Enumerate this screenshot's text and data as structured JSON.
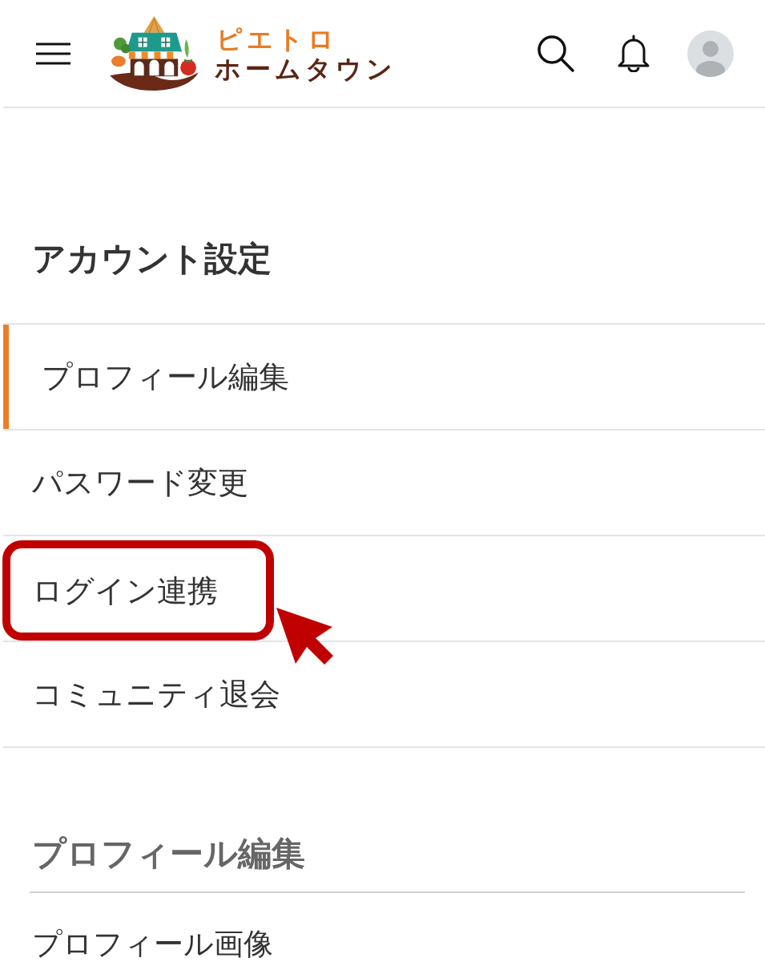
{
  "header": {
    "logo": {
      "line_1": "ピエトロ",
      "line_2": "ホームタウン"
    }
  },
  "account_settings": {
    "title": "アカウント設定",
    "menu": [
      {
        "label": "プロフィール編集",
        "selected": true,
        "highlighted": false
      },
      {
        "label": "パスワード変更",
        "selected": false,
        "highlighted": false
      },
      {
        "label": "ログイン連携",
        "selected": false,
        "highlighted": true
      },
      {
        "label": "コミュニティ退会",
        "selected": false,
        "highlighted": false
      }
    ]
  },
  "profile_section": {
    "title": "プロフィール編集",
    "fields": [
      {
        "label": "プロフィール画像"
      }
    ]
  }
}
